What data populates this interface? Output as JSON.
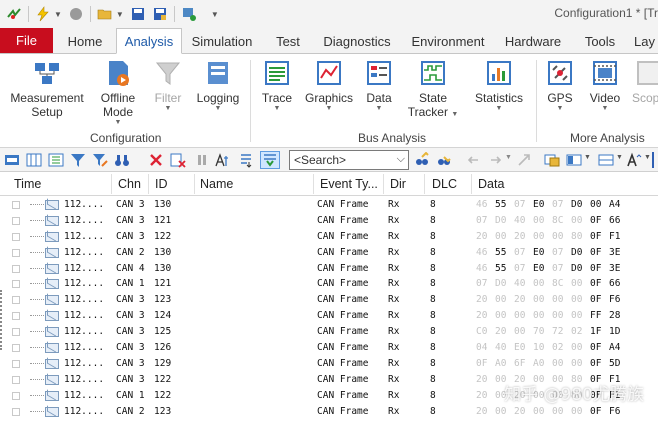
{
  "title": "Configuration1 * [Tr",
  "tabs": {
    "file": "File",
    "items": [
      "Home",
      "Analysis",
      "Simulation",
      "Test",
      "Diagnostics",
      "Environment",
      "Hardware",
      "Tools",
      "Lay"
    ],
    "active": "Analysis"
  },
  "ribbon": {
    "configuration": {
      "label": "Configuration",
      "buttons": [
        {
          "line1": "Measurement",
          "line2": "Setup"
        },
        {
          "line1": "Offline",
          "line2": "Mode"
        },
        {
          "line1": "Filter",
          "line2": ""
        },
        {
          "line1": "Logging",
          "line2": ""
        }
      ]
    },
    "bus_analysis": {
      "label": "Bus Analysis",
      "buttons": [
        {
          "line1": "Trace",
          "line2": ""
        },
        {
          "line1": "Graphics",
          "line2": ""
        },
        {
          "line1": "Data",
          "line2": ""
        },
        {
          "line1": "State",
          "line2": "Tracker"
        },
        {
          "line1": "Statistics",
          "line2": ""
        }
      ]
    },
    "more_analysis": {
      "label": "More Analysis",
      "buttons": [
        {
          "line1": "GPS",
          "line2": ""
        },
        {
          "line1": "Video",
          "line2": ""
        },
        {
          "line1": "Scop",
          "line2": ""
        }
      ]
    }
  },
  "toolbar": {
    "search_placeholder": "<Search>"
  },
  "table": {
    "headers": [
      "Time",
      "Chn",
      "ID",
      "Name",
      "Event Ty...",
      "Dir",
      "DLC",
      "Data"
    ],
    "rows": [
      {
        "time": "112....",
        "chn": "CAN 3",
        "id": "130",
        "event": "CAN Frame",
        "dir": "Rx",
        "dlc": "8",
        "data": [
          "46",
          "55",
          "07",
          "E0",
          "07",
          "D0",
          "00",
          "A4"
        ],
        "faint": [
          0,
          2,
          4
        ]
      },
      {
        "time": "112....",
        "chn": "CAN 3",
        "id": "121",
        "event": "CAN Frame",
        "dir": "Rx",
        "dlc": "8",
        "data": [
          "07",
          "D0",
          "40",
          "00",
          "8C",
          "00",
          "0F",
          "66"
        ],
        "faint": [
          0,
          1,
          2,
          3,
          4,
          5
        ]
      },
      {
        "time": "112....",
        "chn": "CAN 3",
        "id": "122",
        "event": "CAN Frame",
        "dir": "Rx",
        "dlc": "8",
        "data": [
          "20",
          "00",
          "20",
          "00",
          "00",
          "80",
          "0F",
          "F1"
        ],
        "faint": [
          0,
          1,
          2,
          3,
          4,
          5
        ]
      },
      {
        "time": "112....",
        "chn": "CAN 2",
        "id": "130",
        "event": "CAN Frame",
        "dir": "Rx",
        "dlc": "8",
        "data": [
          "46",
          "55",
          "07",
          "E0",
          "07",
          "D0",
          "0F",
          "3E"
        ],
        "faint": [
          0,
          2,
          4
        ]
      },
      {
        "time": "112....",
        "chn": "CAN 4",
        "id": "130",
        "event": "CAN Frame",
        "dir": "Rx",
        "dlc": "8",
        "data": [
          "46",
          "55",
          "07",
          "E0",
          "07",
          "D0",
          "0F",
          "3E"
        ],
        "faint": [
          0,
          2,
          4
        ]
      },
      {
        "time": "112....",
        "chn": "CAN 1",
        "id": "121",
        "event": "CAN Frame",
        "dir": "Rx",
        "dlc": "8",
        "data": [
          "07",
          "D0",
          "40",
          "00",
          "8C",
          "00",
          "0F",
          "66"
        ],
        "faint": [
          0,
          1,
          2,
          3,
          4,
          5
        ]
      },
      {
        "time": "112....",
        "chn": "CAN 3",
        "id": "123",
        "event": "CAN Frame",
        "dir": "Rx",
        "dlc": "8",
        "data": [
          "20",
          "00",
          "20",
          "00",
          "00",
          "00",
          "0F",
          "F6"
        ],
        "faint": [
          0,
          1,
          2,
          3,
          4,
          5
        ]
      },
      {
        "time": "112....",
        "chn": "CAN 3",
        "id": "124",
        "event": "CAN Frame",
        "dir": "Rx",
        "dlc": "8",
        "data": [
          "20",
          "00",
          "00",
          "00",
          "00",
          "00",
          "FF",
          "28"
        ],
        "faint": [
          0,
          1,
          2,
          3,
          4,
          5
        ]
      },
      {
        "time": "112....",
        "chn": "CAN 3",
        "id": "125",
        "event": "CAN Frame",
        "dir": "Rx",
        "dlc": "8",
        "data": [
          "C0",
          "20",
          "00",
          "70",
          "72",
          "02",
          "1F",
          "1D"
        ],
        "faint": [
          0,
          1,
          2,
          3,
          4,
          5
        ]
      },
      {
        "time": "112....",
        "chn": "CAN 3",
        "id": "126",
        "event": "CAN Frame",
        "dir": "Rx",
        "dlc": "8",
        "data": [
          "04",
          "40",
          "E0",
          "10",
          "02",
          "00",
          "0F",
          "A4"
        ],
        "faint": [
          0,
          1,
          2,
          3,
          4,
          5
        ]
      },
      {
        "time": "112....",
        "chn": "CAN 3",
        "id": "129",
        "event": "CAN Frame",
        "dir": "Rx",
        "dlc": "8",
        "data": [
          "0F",
          "A0",
          "6F",
          "A0",
          "00",
          "00",
          "0F",
          "5D"
        ],
        "faint": [
          0,
          1,
          2,
          3,
          4,
          5
        ]
      },
      {
        "time": "112....",
        "chn": "CAN 3",
        "id": "122",
        "event": "CAN Frame",
        "dir": "Rx",
        "dlc": "8",
        "data": [
          "20",
          "00",
          "20",
          "00",
          "00",
          "80",
          "0F",
          "F1"
        ],
        "faint": [
          0,
          1,
          2,
          3,
          4,
          5
        ]
      },
      {
        "time": "112....",
        "chn": "CAN 1",
        "id": "122",
        "event": "CAN Frame",
        "dir": "Rx",
        "dlc": "8",
        "data": [
          "20",
          "00",
          "20",
          "00",
          "00",
          "80",
          "0F",
          "F1"
        ],
        "faint": [
          0,
          1,
          2,
          3,
          4,
          5
        ]
      },
      {
        "time": "112....",
        "chn": "CAN 2",
        "id": "123",
        "event": "CAN Frame",
        "dir": "Rx",
        "dlc": "8",
        "data": [
          "20",
          "00",
          "20",
          "00",
          "00",
          "00",
          "0F",
          "F6"
        ],
        "faint": [
          0,
          1,
          2,
          3,
          4,
          5
        ]
      }
    ]
  },
  "watermark": "知乎 @980尤腾族",
  "colors": {
    "file_tab": "#c80d1e",
    "accent": "#1e5aa8"
  }
}
